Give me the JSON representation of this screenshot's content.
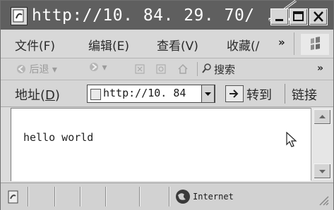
{
  "window": {
    "title": "http://10. 84. 29. 70/ ..."
  },
  "menubar": {
    "items": [
      {
        "label": "文件(F)"
      },
      {
        "label": "编辑(E)"
      },
      {
        "label": "查看(V)"
      },
      {
        "label": "收藏(/"
      }
    ],
    "overflow": "»"
  },
  "toolbar": {
    "back_label": "后退",
    "search_label": "搜索",
    "overflow": "»"
  },
  "addressbar": {
    "label_prefix": "地址(",
    "label_accel": "D",
    "label_suffix": ")",
    "url": "http://10. 84",
    "go_label": "转到",
    "links_label": "链接"
  },
  "page": {
    "text": "hello world"
  },
  "statusbar": {
    "zone_label": "Internet"
  },
  "colors": {
    "titlebar": "#5f5f5f",
    "chrome": "#d8d8d8",
    "content_bg": "#ffffff"
  },
  "icons": [
    "ie-page-icon",
    "minimize-icon",
    "maximize-icon",
    "close-icon",
    "windows-logo-icon",
    "back-icon",
    "forward-icon",
    "stop-icon",
    "refresh-icon",
    "home-icon",
    "search-icon",
    "go-arrow-icon",
    "mouse-cursor-icon",
    "globe-icon"
  ]
}
